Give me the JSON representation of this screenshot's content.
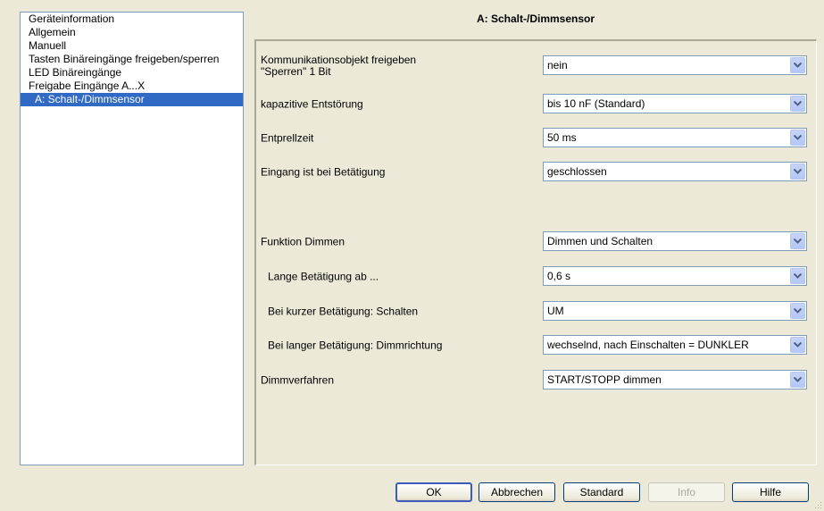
{
  "sidebar": {
    "items": [
      {
        "label": "Geräteinformation"
      },
      {
        "label": "Allgemein"
      },
      {
        "label": "Manuell"
      },
      {
        "label": "Tasten Binäreingänge freigeben/sperren"
      },
      {
        "label": "LED Binäreingänge"
      },
      {
        "label": "Freigabe Eingänge A...X"
      },
      {
        "label": "A: Schalt-/Dimmsensor"
      }
    ]
  },
  "panel": {
    "title": "A: Schalt-/Dimmsensor",
    "params": [
      {
        "label_line1": "Kommunikationsobjekt freigeben",
        "label_line2": "\"Sperren\" 1 Bit",
        "value": "nein"
      },
      {
        "label": "kapazitive Entstörung",
        "value": "bis 10 nF (Standard)"
      },
      {
        "label": "Entprellzeit",
        "value": "50 ms"
      },
      {
        "label": "Eingang ist bei Betätigung",
        "value": "geschlossen"
      },
      {
        "label": "Funktion Dimmen",
        "value": "Dimmen und Schalten"
      },
      {
        "label": "Lange Betätigung ab ...",
        "value": "0,6 s"
      },
      {
        "label": "Bei kurzer Betätigung: Schalten",
        "value": "UM"
      },
      {
        "label": "Bei langer Betätigung: Dimmrichtung",
        "value": "wechselnd, nach Einschalten = DUNKLER"
      },
      {
        "label": "Dimmverfahren",
        "value": "START/STOPP dimmen"
      }
    ]
  },
  "buttons": {
    "ok": "OK",
    "cancel": "Abbrechen",
    "standard": "Standard",
    "info": "Info",
    "help": "Hilfe"
  },
  "colors": {
    "selection": "#316ac5",
    "dialog_bg": "#ece9d8",
    "field_border": "#7f9db9"
  }
}
